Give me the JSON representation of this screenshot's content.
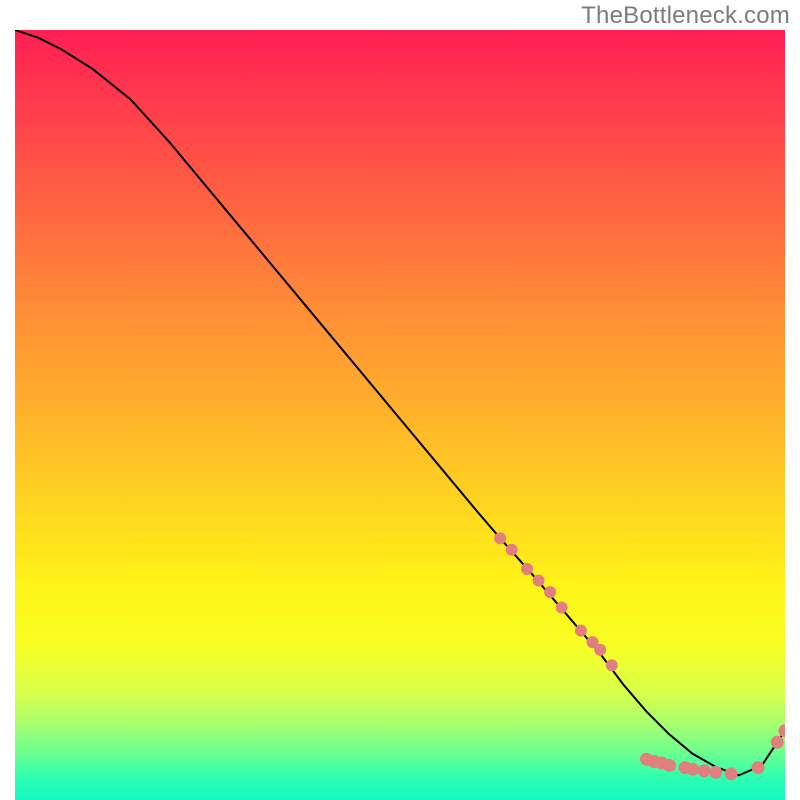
{
  "watermark": "TheBottleneck.com",
  "chart_data": {
    "type": "line",
    "title": "",
    "xlabel": "",
    "ylabel": "",
    "xlim": [
      0,
      100
    ],
    "ylim": [
      0,
      100
    ],
    "grid": false,
    "series": [
      {
        "name": "curve",
        "stroke": "#000000",
        "x": [
          0,
          3,
          6,
          10,
          15,
          20,
          25,
          30,
          35,
          40,
          45,
          50,
          55,
          60,
          63,
          67,
          70,
          73,
          76,
          79,
          82,
          85,
          88,
          91,
          94,
          97,
          100
        ],
        "values": [
          100,
          99,
          97.5,
          95,
          91,
          85.5,
          79.5,
          73.5,
          67.5,
          61.5,
          55.5,
          49.5,
          43.5,
          37.5,
          34,
          29.5,
          26,
          22.5,
          19,
          15,
          11.5,
          8.5,
          6,
          4.3,
          3.2,
          4.5,
          9
        ]
      }
    ],
    "markers": [
      {
        "name": "points-upper",
        "color": "#e07f7d",
        "r": 6,
        "x": [
          63,
          64.5,
          66.5,
          68,
          69.5,
          71,
          73.5,
          75,
          76,
          77.5
        ],
        "y": [
          34,
          32.5,
          30,
          28.5,
          27,
          25,
          22,
          20.5,
          19.5,
          17.5
        ]
      },
      {
        "name": "points-bottom",
        "color": "#e07f7d",
        "r": 6.5,
        "x": [
          82,
          83,
          84,
          85,
          87,
          88,
          89.5,
          91,
          93,
          96.5
        ],
        "y": [
          5.3,
          5.0,
          4.8,
          4.5,
          4.2,
          4.0,
          3.8,
          3.6,
          3.4,
          4.2
        ]
      },
      {
        "name": "points-end",
        "color": "#e07f7d",
        "r": 6.5,
        "x": [
          99,
          100
        ],
        "y": [
          7.5,
          9
        ]
      }
    ]
  },
  "colors": {
    "curve": "#000000",
    "marker": "#e07f7d",
    "watermark": "#7c7c7c"
  }
}
